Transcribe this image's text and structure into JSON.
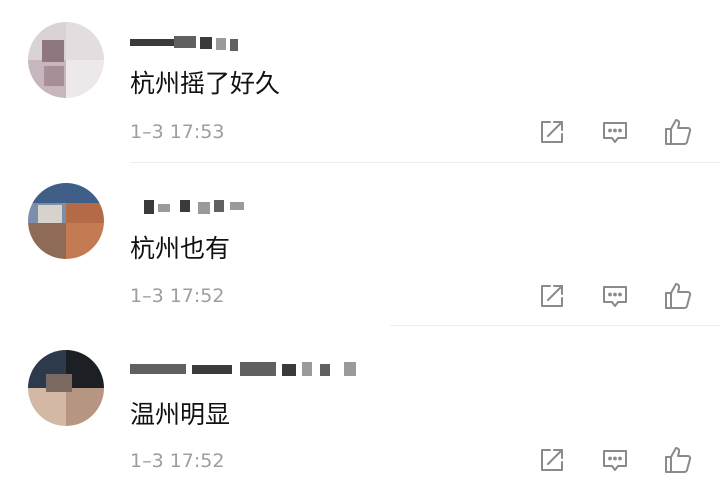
{
  "comments": [
    {
      "content": "杭州摇了好久",
      "time": "1–3 17:53"
    },
    {
      "content": "杭州也有",
      "time": "1–3 17:52"
    },
    {
      "content": "温州明显",
      "time": "1–3 17:52"
    }
  ],
  "icons": {
    "share": "share-icon",
    "comment": "comment-icon",
    "like": "like-icon"
  },
  "colors": {
    "text": "#111111",
    "time": "#9e9e9e",
    "icon": "#8a8a8a",
    "divider": "#ececec"
  }
}
